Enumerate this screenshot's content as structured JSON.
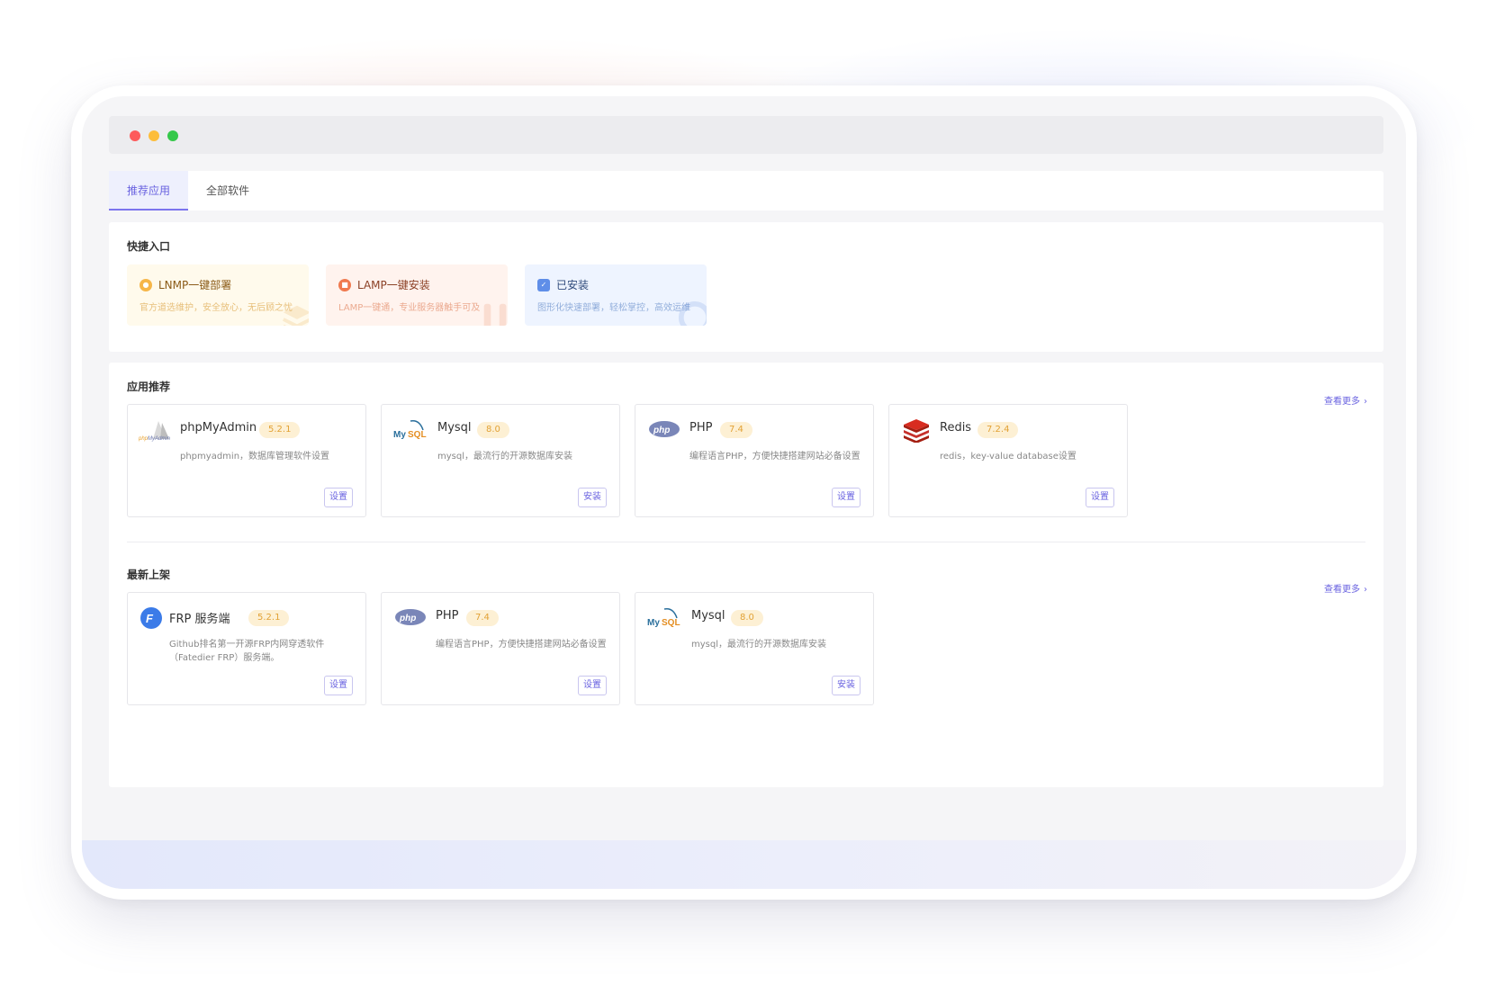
{
  "tabs": [
    {
      "label": "推荐应用",
      "active": true
    },
    {
      "label": "全部软件",
      "active": false
    }
  ],
  "quick_entry": {
    "title": "快捷入口",
    "items": [
      {
        "title": "LNMP一键部署",
        "desc": "官方道选维护，安全放心，无后顾之忧",
        "icon": "lnmp-icon"
      },
      {
        "title": "LAMP一键安装",
        "desc": "LAMP一键通，专业服务器触手可及",
        "icon": "lamp-icon"
      },
      {
        "title": "已安装",
        "desc": "图形化快速部署，轻松掌控，高效运维",
        "icon": "installed-icon"
      }
    ]
  },
  "recommended": {
    "title": "应用推荐",
    "more": "查看更多",
    "apps": [
      {
        "name": "phpMyAdmin",
        "version": "5.2.1",
        "desc": "phpmyadmin，数据库管理软件设置",
        "button": "设置",
        "icon": "phpmyadmin-icon"
      },
      {
        "name": "Mysql",
        "version": "8.0",
        "desc": "mysql，最流行的开源数据库安装",
        "button": "安装",
        "icon": "mysql-icon"
      },
      {
        "name": "PHP",
        "version": "7.4",
        "desc": "编程语言PHP，方便快捷搭建网站必备设置",
        "button": "设置",
        "icon": "php-icon"
      },
      {
        "name": "Redis",
        "version": "7.2.4",
        "desc": "redis，key-value database设置",
        "button": "设置",
        "icon": "redis-icon"
      }
    ]
  },
  "latest": {
    "title": "最新上架",
    "more": "查看更多",
    "apps": [
      {
        "name": "FRP 服务端",
        "version": "5.2.1",
        "desc_line1": "Github排名第一开源FRP内网穿透软件",
        "desc_line2": "（Fatedier FRP）服务端。",
        "button": "设置",
        "icon": "frp-icon"
      },
      {
        "name": "PHP",
        "version": "7.4",
        "desc": "编程语言PHP，方便快捷搭建网站必备设置",
        "button": "设置",
        "icon": "php-icon"
      },
      {
        "name": "Mysql",
        "version": "8.0",
        "desc": "mysql，最流行的开源数据库安装",
        "button": "安装",
        "icon": "mysql-icon"
      }
    ]
  },
  "colors": {
    "accent": "#6a63e0",
    "version_badge_bg": "#fdf0d4",
    "version_badge_text": "#e2a236"
  }
}
